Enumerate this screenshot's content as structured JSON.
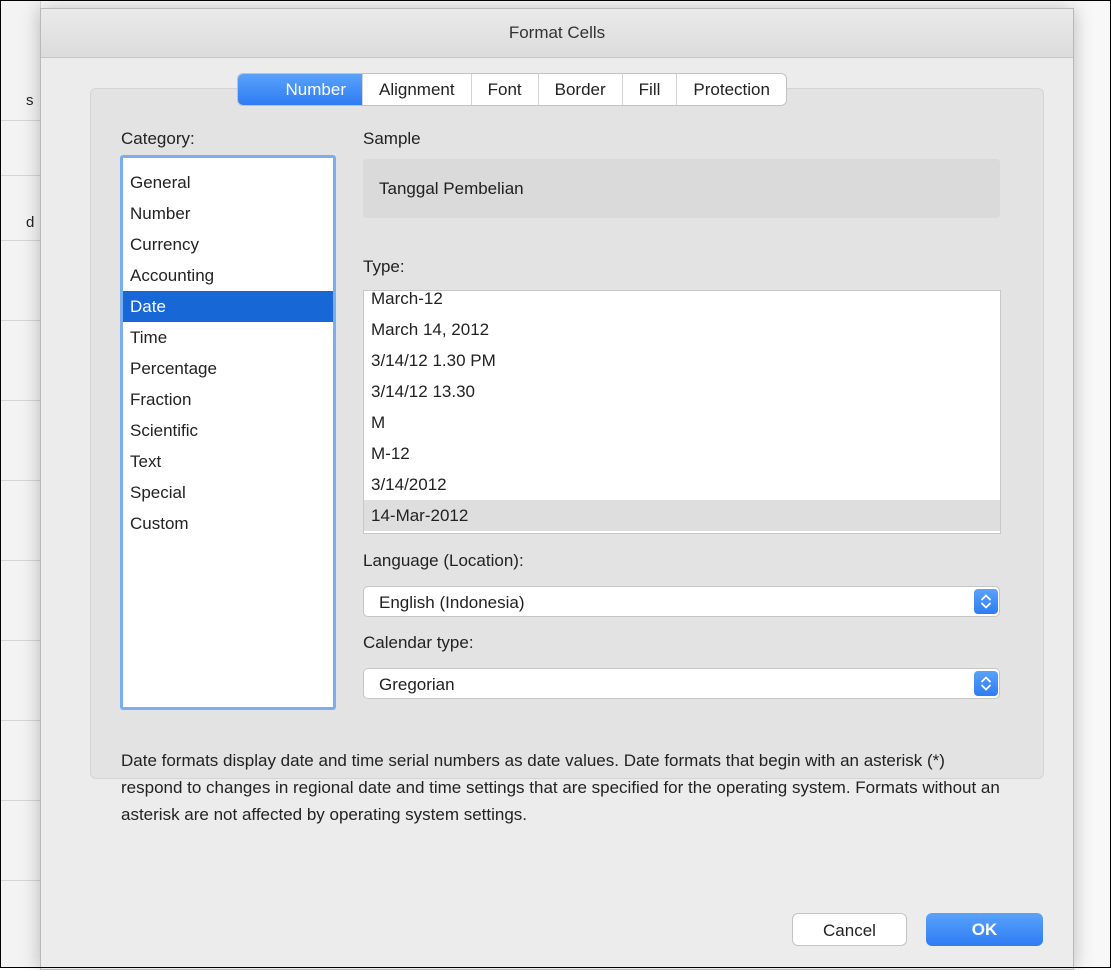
{
  "background": {
    "left_labels": [
      "s",
      "d"
    ]
  },
  "dialog": {
    "title": "Format Cells",
    "tabs": [
      {
        "label": "Number",
        "active": true
      },
      {
        "label": "Alignment",
        "active": false
      },
      {
        "label": "Font",
        "active": false
      },
      {
        "label": "Border",
        "active": false
      },
      {
        "label": "Fill",
        "active": false
      },
      {
        "label": "Protection",
        "active": false
      }
    ],
    "category_label": "Category:",
    "categories": [
      "General",
      "Number",
      "Currency",
      "Accounting",
      "Date",
      "Time",
      "Percentage",
      "Fraction",
      "Scientific",
      "Text",
      "Special",
      "Custom"
    ],
    "selected_category": "Date",
    "sample_label": "Sample",
    "sample_value": "Tanggal Pembelian",
    "type_label": "Type:",
    "types": [
      "March-12",
      "March 14, 2012",
      "3/14/12 1.30 PM",
      "3/14/12 13.30",
      "M",
      "M-12",
      "3/14/2012",
      "14-Mar-2012"
    ],
    "selected_type": "14-Mar-2012",
    "language_label": "Language (Location):",
    "language_value": "English (Indonesia)",
    "calendar_label": "Calendar type:",
    "calendar_value": "Gregorian",
    "description": "Date formats display date and time serial numbers as date values.  Date formats that begin with an asterisk (*) respond to changes in regional date and time settings that are specified for the operating system. Formats without an asterisk are not affected by operating system settings.",
    "cancel_label": "Cancel",
    "ok_label": "OK"
  },
  "colors": {
    "accent": "#2d7cf4",
    "selection": "#1867d6",
    "focus_ring": "#7aaef0"
  }
}
